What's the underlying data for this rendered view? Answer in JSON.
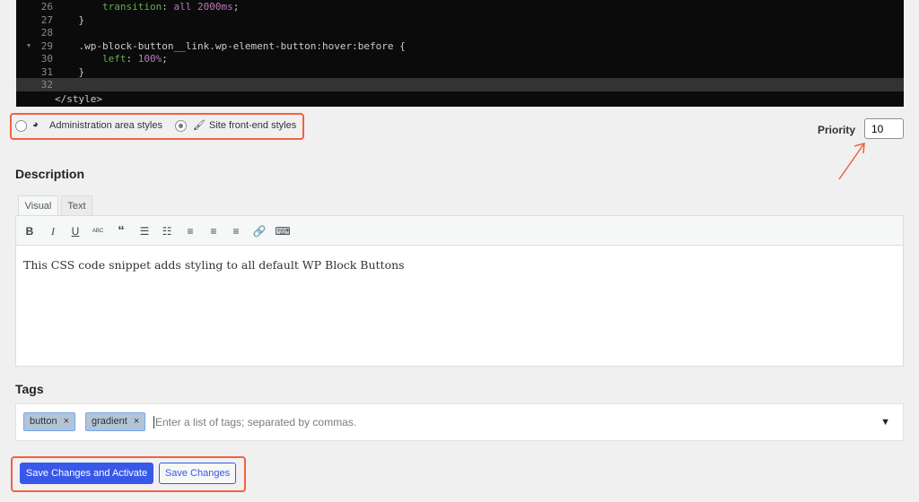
{
  "code": {
    "lines": [
      {
        "n": "26",
        "parts": [
          [
            "    ",
            ""
          ],
          [
            "transition",
            "kw"
          ],
          [
            ": ",
            ""
          ],
          [
            "all 2000ms",
            "val"
          ],
          [
            ";",
            ""
          ]
        ]
      },
      {
        "n": "27",
        "parts": [
          [
            "}",
            ""
          ]
        ]
      },
      {
        "n": "28",
        "parts": []
      },
      {
        "n": "29",
        "fold": true,
        "parts": [
          [
            ".wp-block-button__link.wp-element-button:hover:before {",
            ""
          ]
        ]
      },
      {
        "n": "30",
        "parts": [
          [
            "    ",
            ""
          ],
          [
            "left",
            "kw"
          ],
          [
            ": ",
            ""
          ],
          [
            "100%",
            "val"
          ],
          [
            ";",
            ""
          ]
        ]
      },
      {
        "n": "31",
        "parts": [
          [
            "}",
            ""
          ]
        ]
      },
      {
        "n": "32",
        "parts": [],
        "highlight": true
      }
    ],
    "closing": "</style>"
  },
  "scope": {
    "admin_label": "Administration area styles",
    "admin_icon": "dashboard-icon",
    "site_label": "Site front-end styles",
    "site_icon": "paintbrush-icon",
    "selected": "site"
  },
  "priority": {
    "label": "Priority",
    "value": "10"
  },
  "description": {
    "heading": "Description",
    "tabs": [
      "Visual",
      "Text"
    ],
    "active_tab": "Visual",
    "toolbar": [
      "bold",
      "italic",
      "underline",
      "strikethrough",
      "blockquote",
      "bullet-list",
      "numbered-list",
      "align-left",
      "align-center",
      "align-right",
      "link",
      "toolbar-toggle"
    ],
    "content": "This CSS code snippet adds styling to all default WP Block Buttons"
  },
  "tags": {
    "heading": "Tags",
    "items": [
      "button",
      "gradient"
    ],
    "placeholder": "Enter a list of tags; separated by commas."
  },
  "actions": {
    "primary": "Save Changes and Activate",
    "secondary": "Save Changes"
  },
  "colors": {
    "accent": "#3858e9",
    "annotation": "#f0623f"
  }
}
